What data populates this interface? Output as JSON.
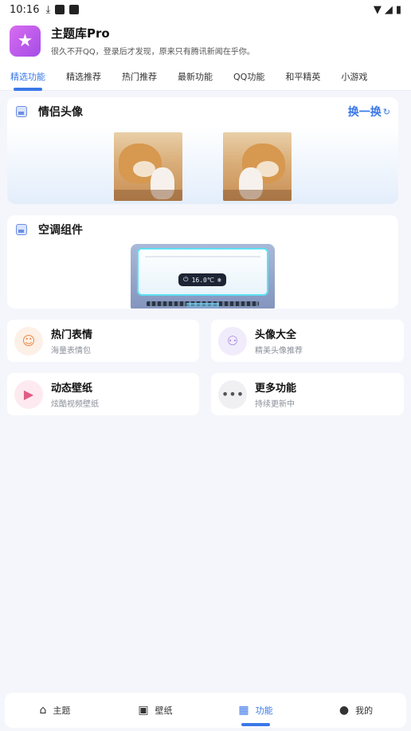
{
  "status": {
    "time": "10:16"
  },
  "app": {
    "title": "主题库Pro",
    "subtitle": "很久不开QQ，登录后才发现，原来只有腾讯新闻在乎你。"
  },
  "tabs": [
    {
      "label": "精选功能",
      "active": true
    },
    {
      "label": "精选推荐"
    },
    {
      "label": "热门推荐"
    },
    {
      "label": "最新功能"
    },
    {
      "label": "QQ功能"
    },
    {
      "label": "和平精英"
    },
    {
      "label": "小游戏"
    }
  ],
  "couple_card": {
    "title": "情侣头像",
    "action": "换一换",
    "action_icon": "↻"
  },
  "ac_card": {
    "title": "空调组件",
    "temperature": "16.0℃"
  },
  "features": [
    {
      "title": "热门表情",
      "subtitle": "海量表情包",
      "icon": "smile-icon",
      "color": "#f08a4a"
    },
    {
      "title": "头像大全",
      "subtitle": "精美头像推荐",
      "icon": "user-icon",
      "color": "#9b7bd8"
    },
    {
      "title": "动态壁纸",
      "subtitle": "炫酷视频壁纸",
      "icon": "video-icon",
      "color": "#e25a86"
    },
    {
      "title": "更多功能",
      "subtitle": "持续更新中",
      "icon": "more-icon",
      "color": "#555555"
    }
  ],
  "bottom_nav": [
    {
      "label": "主题",
      "icon": "home-icon"
    },
    {
      "label": "壁纸",
      "icon": "image-icon"
    },
    {
      "label": "功能",
      "icon": "grid-icon",
      "active": true
    },
    {
      "label": "我的",
      "icon": "person-icon"
    }
  ]
}
